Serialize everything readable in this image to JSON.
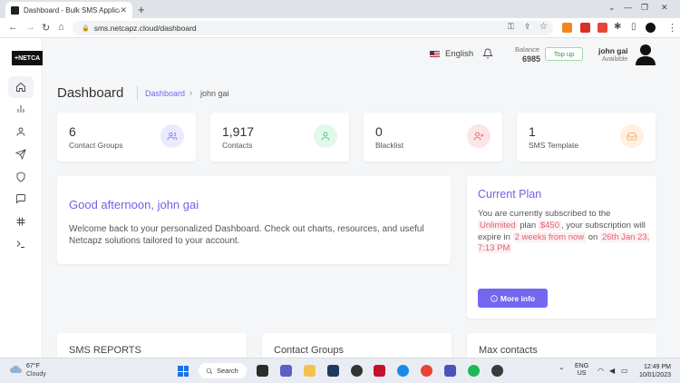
{
  "browser": {
    "tab_title": "Dashboard - Bulk SMS Applicatio...",
    "url": "sms.netcapz.cloud/dashboard"
  },
  "sidebar": {
    "logo_text": "+NETCA",
    "items": [
      "home-icon",
      "bar-chart-icon",
      "user-icon",
      "send-icon",
      "shield-icon",
      "message-icon",
      "settings-hub-icon",
      "terminal-icon"
    ]
  },
  "header": {
    "language": "English",
    "balance_label": "Balance",
    "balance_value": "6985",
    "topup_label": "Top up",
    "user_name": "john gai",
    "user_status": "Available"
  },
  "page": {
    "title": "Dashboard",
    "breadcrumb": [
      "Dashboard",
      "john gai"
    ]
  },
  "stats": [
    {
      "value": "6",
      "label": "Contact Groups",
      "icon": "users-icon",
      "color": "#7367f0"
    },
    {
      "value": "1,917",
      "label": "Contacts",
      "icon": "user-icon",
      "color": "#28c76f"
    },
    {
      "value": "0",
      "label": "Blacklist",
      "icon": "user-x-icon",
      "color": "#ea5455"
    },
    {
      "value": "1",
      "label": "SMS Template",
      "icon": "inbox-icon",
      "color": "#ff9f43"
    }
  ],
  "welcome": {
    "title": "Good afternoon, john gai",
    "text": "Welcome back to your personalized Dashboard. Check out charts, resources, and useful Netcapz solutions tailored to your account."
  },
  "plan": {
    "title": "Current Plan",
    "t1": "You are currently subscribed to the",
    "plan_name": "Unlimited",
    "t2": "plan",
    "price": "$450",
    "t3": ", your subscription will expire in",
    "expire_in": "2 weeks from now",
    "t4": "on",
    "expire_date": "26th Jan 23, 7:13 PM",
    "button": "More info",
    "button_icon": "info-circle-icon"
  },
  "bottom_cards": [
    "SMS REPORTS",
    "Contact Groups",
    "Max contacts"
  ],
  "taskbar": {
    "temp": "67°F",
    "condition": "Cloudy",
    "search_label": "Search",
    "lang_line1": "ENG",
    "lang_line2": "US",
    "time": "12:49 PM",
    "date": "10/01/2023"
  }
}
